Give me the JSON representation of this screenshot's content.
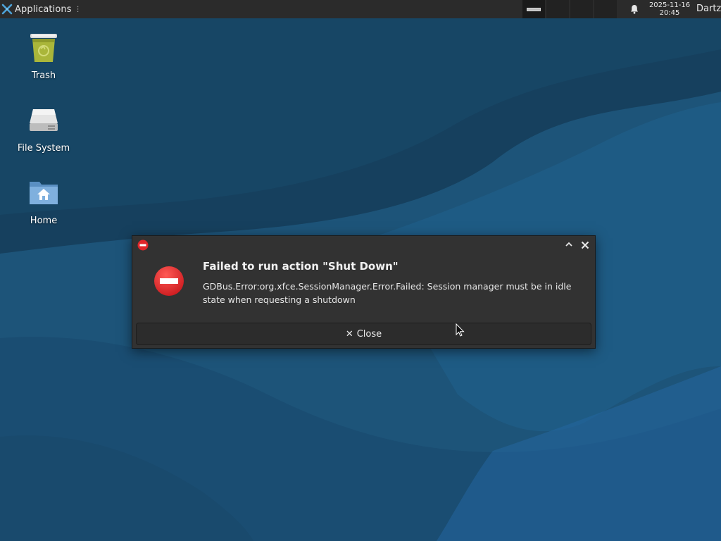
{
  "panel": {
    "applications_label": "Applications",
    "clock_date": "2025-11-16",
    "clock_time": "20:45",
    "user_name": "Dartz"
  },
  "desktop_icons": [
    {
      "label": "Trash",
      "icon": "trash-icon"
    },
    {
      "label": "File System",
      "icon": "drive-icon"
    },
    {
      "label": "Home",
      "icon": "home-folder-icon"
    }
  ],
  "dialog": {
    "heading": "Failed to run action \"Shut Down\"",
    "message": "GDBus.Error:org.xfce.SessionManager.Error.Failed: Session manager must be in idle state when requesting a shutdown",
    "close_button_label": "Close",
    "title_icon": "error-icon",
    "big_icon": "error-icon"
  },
  "colors": {
    "panel_bg": "#2b2b2b",
    "dialog_bg": "#323232",
    "error_red": "#e0262a",
    "wallpaper": "#1c5278"
  }
}
